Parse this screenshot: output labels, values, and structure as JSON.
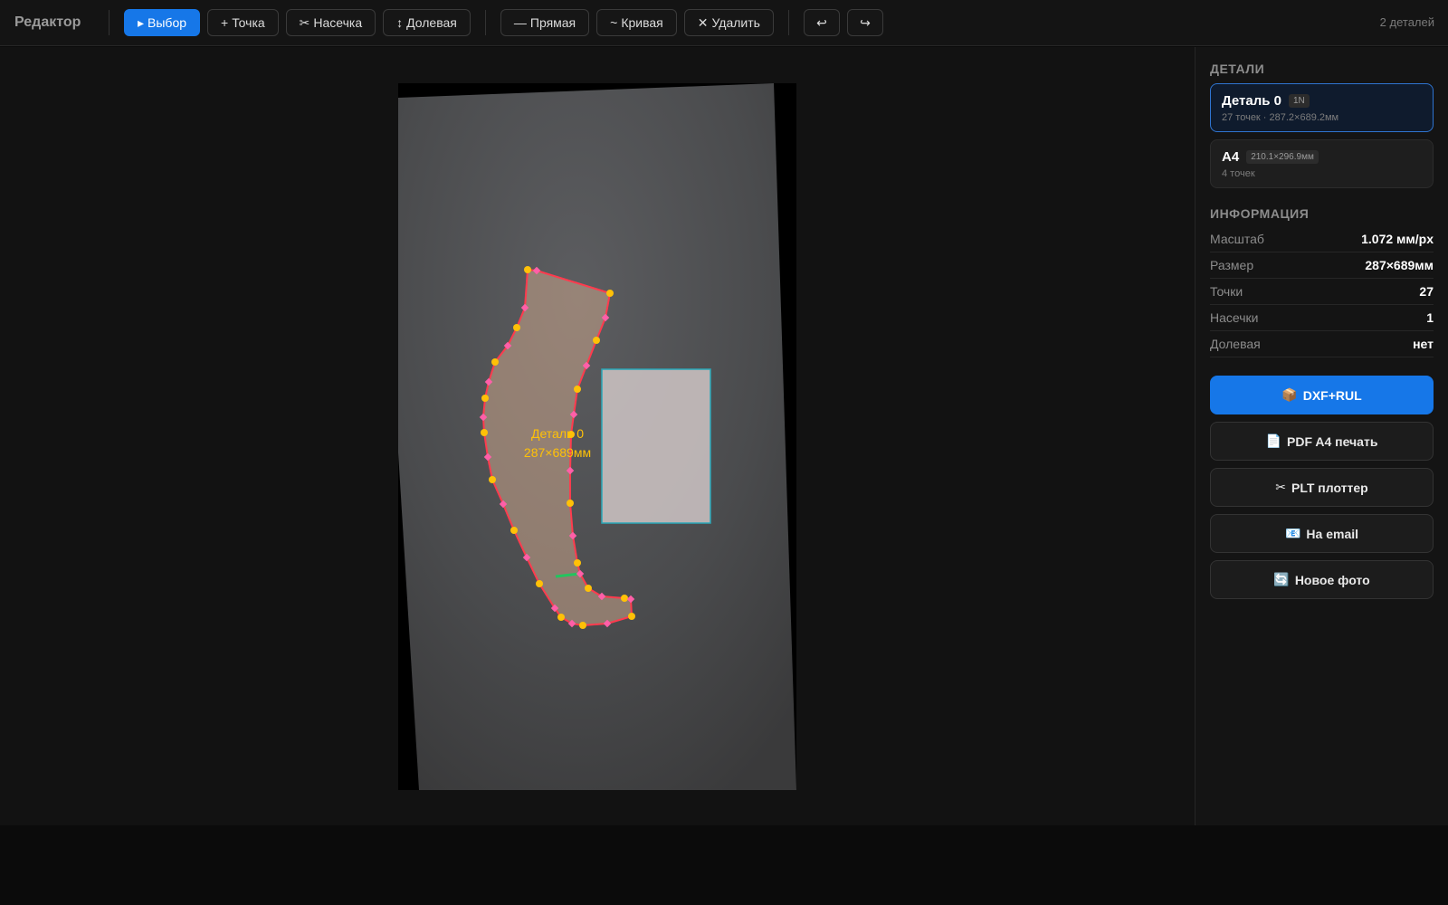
{
  "app": {
    "title": "Редактор",
    "detail_count": "2 деталей"
  },
  "toolbar": {
    "tools": [
      {
        "icon": "▸",
        "label": "Выбор",
        "active": true
      },
      {
        "icon": "+",
        "label": "Точка"
      },
      {
        "icon": "✂",
        "label": "Насечка"
      },
      {
        "icon": "↕",
        "label": "Долевая"
      }
    ],
    "shapes": [
      {
        "icon": "—",
        "label": "Прямая"
      },
      {
        "icon": "~",
        "label": "Кривая"
      },
      {
        "icon": "✕",
        "label": "Удалить"
      }
    ],
    "history": {
      "undo": "↩",
      "redo": "↪"
    }
  },
  "canvas": {
    "piece_label": "Деталь 0",
    "piece_dims": "287×689мм",
    "colors": {
      "outline": "#ff3b4e",
      "point": "#ffc107",
      "curve_point": "#ff5fa8",
      "notch": "#22c55e",
      "label": "#ffc107",
      "a4_outline": "#2aa7b8"
    }
  },
  "sidebar": {
    "details_title": "ДЕТАЛИ",
    "details": [
      {
        "name": "Деталь 0",
        "badge": "1N",
        "sub": "27 точек · 287.2×689.2мм",
        "selected": true
      },
      {
        "name": "A4",
        "badge": "210.1×296.9мм",
        "sub": "4 точек",
        "selected": false
      }
    ],
    "info_title": "ИНФОРМАЦИЯ",
    "info": [
      {
        "key": "Масштаб",
        "value": "1.072 мм/px"
      },
      {
        "key": "Размер",
        "value": "287×689мм"
      },
      {
        "key": "Точки",
        "value": "27"
      },
      {
        "key": "Насечки",
        "value": "1"
      },
      {
        "key": "Долевая",
        "value": "нет"
      }
    ],
    "actions": [
      {
        "icon": "📦",
        "label": "DXF+RUL",
        "primary": true
      },
      {
        "icon": "📄",
        "label": "PDF A4 печать"
      },
      {
        "icon": "✂",
        "label": "PLT плоттер"
      },
      {
        "icon": "📧",
        "label": "На email"
      },
      {
        "icon": "🔄",
        "label": "Новое фото"
      }
    ]
  }
}
